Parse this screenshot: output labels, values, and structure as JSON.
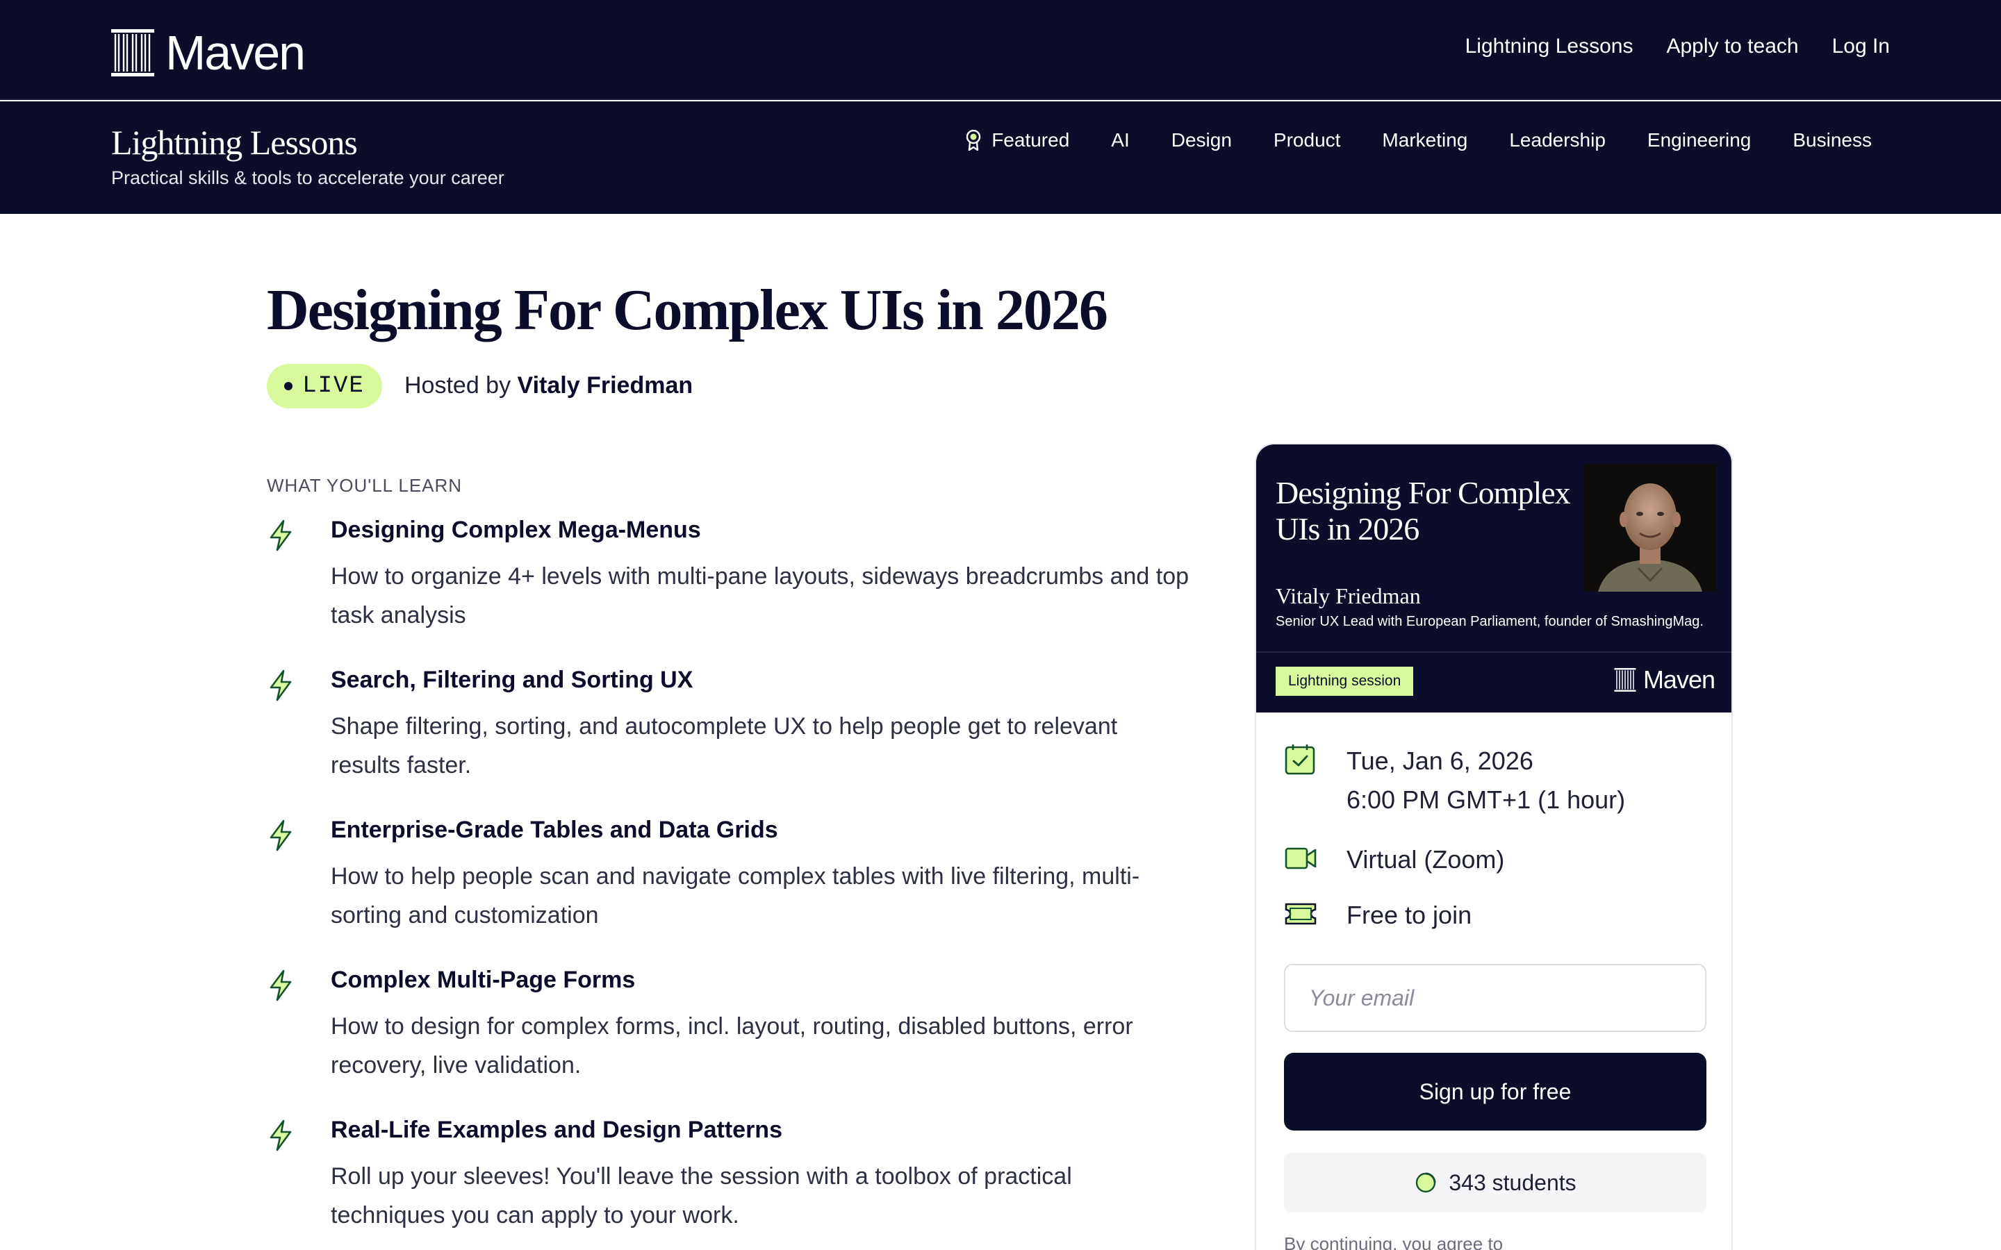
{
  "brand": {
    "name": "Maven"
  },
  "top_nav": {
    "items": [
      "Lightning Lessons",
      "Apply to teach",
      "Log In"
    ]
  },
  "section": {
    "title": "Lightning Lessons",
    "subtitle": "Practical skills & tools to accelerate your career",
    "categories": [
      "Featured",
      "AI",
      "Design",
      "Product",
      "Marketing",
      "Leadership",
      "Engineering",
      "Business"
    ]
  },
  "lesson": {
    "title": "Designing For Complex UIs in 2026",
    "status": "LIVE",
    "hosted_prefix": "Hosted by",
    "host": "Vitaly Friedman"
  },
  "learn": {
    "heading": "WHAT YOU'LL LEARN",
    "items": [
      {
        "title": "Designing Complex Mega-Menus",
        "desc": "How to organize 4+ levels with multi-pane layouts, sideways breadcrumbs and top task analysis"
      },
      {
        "title": "Search, Filtering and Sorting UX",
        "desc": "Shape filtering, sorting, and autocomplete UX to help people get to relevant results faster."
      },
      {
        "title": "Enterprise-Grade Tables and Data Grids",
        "desc": "How to help people scan and navigate complex tables with live filtering, multi-sorting and customization"
      },
      {
        "title": "Complex Multi-Page Forms",
        "desc": "How to design for complex forms, incl. layout, routing, disabled buttons, error recovery, live validation."
      },
      {
        "title": "Real-Life Examples and Design Patterns",
        "desc": "Roll up your sleeves! You'll leave the session with a toolbox of practical techniques you can apply to your work."
      }
    ]
  },
  "card": {
    "banner_title": "Designing For Complex UIs in 2026",
    "host_name": "Vitaly Friedman",
    "host_role": "Senior UX Lead with European Parliament, founder of SmashingMag.",
    "badge": "Lightning session",
    "brand": "Maven",
    "date": "Tue, Jan 6, 2026",
    "time": "6:00 PM GMT+1 (1 hour)",
    "location": "Virtual (Zoom)",
    "price": "Free to join",
    "email_placeholder": "Your email",
    "signup_label": "Sign up for free",
    "students": "343 students",
    "fineprint": "By continuing, you agree to"
  },
  "colors": {
    "navy": "#0b0d2a",
    "lime": "#d9f99d",
    "icon_green": "#166534"
  }
}
